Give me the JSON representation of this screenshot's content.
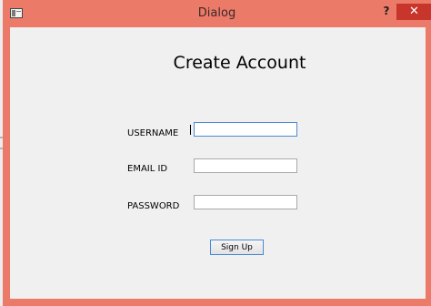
{
  "window": {
    "title": "Dialog",
    "help_label": "?",
    "close_label": "✕"
  },
  "form": {
    "heading": "Create Account",
    "username_label": "USERNAME",
    "username_value": "",
    "email_label": "EMAIL ID",
    "email_value": "",
    "password_label": "PASSWORD",
    "password_value": "",
    "signup_label": "Sign Up"
  },
  "colors": {
    "frame": "#ec7a68",
    "close_button": "#c8352b",
    "client_background": "#f0f0f0",
    "focus_border": "#4a8bd6"
  },
  "icons": {
    "app_icon": "window-app-icon"
  }
}
